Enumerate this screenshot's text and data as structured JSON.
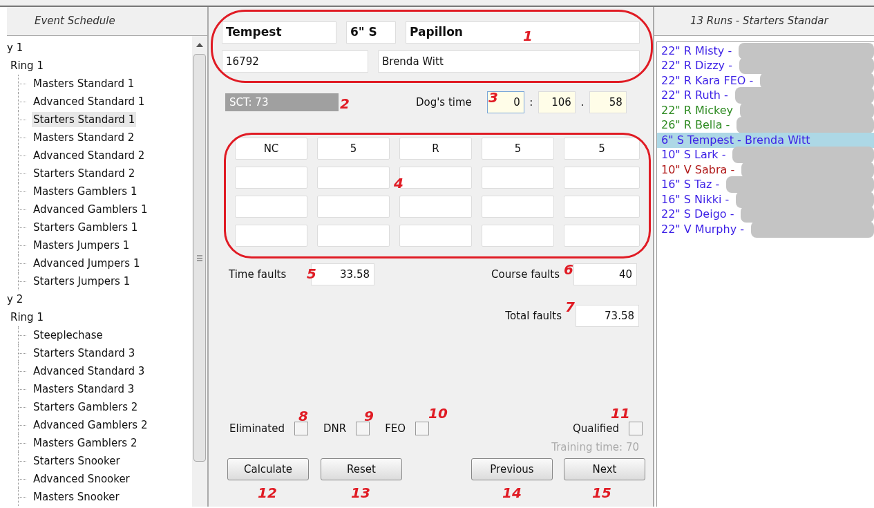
{
  "event_schedule": {
    "title": "Event Schedule",
    "tree": [
      {
        "label": "y 1",
        "expanded": true,
        "children": [
          {
            "label": "Ring 1",
            "expanded": true,
            "children": [
              {
                "label": "Masters Standard 1",
                "selected": false
              },
              {
                "label": "Advanced Standard 1",
                "selected": false
              },
              {
                "label": "Starters Standard 1",
                "selected": true
              },
              {
                "label": "Masters Standard 2",
                "selected": false
              },
              {
                "label": "Advanced Standard 2",
                "selected": false
              },
              {
                "label": "Starters Standard 2",
                "selected": false
              },
              {
                "label": "Masters Gamblers 1",
                "selected": false
              },
              {
                "label": "Advanced Gamblers 1",
                "selected": false
              },
              {
                "label": "Starters Gamblers 1",
                "selected": false
              },
              {
                "label": "Masters Jumpers 1",
                "selected": false
              },
              {
                "label": "Advanced Jumpers 1",
                "selected": false
              },
              {
                "label": "Starters Jumpers 1",
                "selected": false
              }
            ]
          }
        ]
      },
      {
        "label": "y 2",
        "expanded": true,
        "children": [
          {
            "label": "Ring 1",
            "expanded": true,
            "children": [
              {
                "label": "Steeplechase",
                "selected": false
              },
              {
                "label": "Starters Standard 3",
                "selected": false
              },
              {
                "label": "Advanced Standard 3",
                "selected": false
              },
              {
                "label": "Masters Standard 3",
                "selected": false
              },
              {
                "label": "Starters Gamblers 2",
                "selected": false
              },
              {
                "label": "Advanced Gamblers 2",
                "selected": false
              },
              {
                "label": "Masters Gamblers 2",
                "selected": false
              },
              {
                "label": "Starters Snooker",
                "selected": false
              },
              {
                "label": "Advanced Snooker",
                "selected": false
              },
              {
                "label": "Masters Snooker",
                "selected": false
              }
            ]
          }
        ]
      }
    ]
  },
  "entry": {
    "dog_name": "Tempest",
    "height_class": "6\" S",
    "breed": "Papillon",
    "number": "16792",
    "handler": "Brenda Witt"
  },
  "sct": "SCT:  73",
  "dogs_time": {
    "label": "Dog's time",
    "minutes": "0",
    "seconds": "106",
    "hundredths": "58",
    "separators": [
      ":",
      "."
    ]
  },
  "faults_grid": [
    {
      "kind": "entry",
      "cells": [
        "NC",
        "5",
        "R",
        "5",
        "5"
      ]
    },
    {
      "kind": "blank"
    },
    {
      "kind": "blank"
    },
    {
      "kind": "blank"
    }
  ],
  "time_faults": {
    "label": "Time faults",
    "value": "33.58"
  },
  "course_faults": {
    "label": "Course faults",
    "value": "40"
  },
  "total_faults": {
    "label": "Total faults",
    "value": "73.58"
  },
  "flags": [
    {
      "label": "Eliminated",
      "checked": false
    },
    {
      "label": "DNR",
      "checked": false
    },
    {
      "label": "FEO",
      "checked": false
    },
    {
      "label": "Qualified",
      "checked": false
    }
  ],
  "training_time": "Training time:  70",
  "buttons": [
    "Calculate",
    "Reset",
    "Previous",
    "Next"
  ],
  "runs": {
    "title": "13 Runs - Starters Standar",
    "items": [
      {
        "text": "22\" R  Misty  -",
        "color": "#3b1fe6",
        "selected": false,
        "redacted": true
      },
      {
        "text": "22\" R  Dizzy  -",
        "color": "#3b1fe6",
        "selected": false,
        "redacted": true
      },
      {
        "text": "22\" R  Kara FEO  -",
        "color": "#3b1fe6",
        "selected": false,
        "redacted": true
      },
      {
        "text": "22\" R  Ruth  -",
        "color": "#3b1fe6",
        "selected": false,
        "redacted": true
      },
      {
        "text": "22\" R  Mickey",
        "color": "#2e8b22",
        "selected": false,
        "redacted": true
      },
      {
        "text": "26\" R  Bella  -",
        "color": "#2e8b22",
        "selected": false,
        "redacted": true
      },
      {
        "text": "6\" S  Tempest  -  Brenda Witt",
        "color": "#3b1fe6",
        "selected": true,
        "redacted": false
      },
      {
        "text": "10\" S  Lark  -",
        "color": "#3b1fe6",
        "selected": false,
        "redacted": true
      },
      {
        "text": "10\" V  Sabra  -",
        "color": "#b01818",
        "selected": false,
        "redacted": true
      },
      {
        "text": "16\" S  Taz  -",
        "color": "#3b1fe6",
        "selected": false,
        "redacted": true
      },
      {
        "text": "16\" S  Nikki  -",
        "color": "#3b1fe6",
        "selected": false,
        "redacted": true
      },
      {
        "text": "22\" S  Deigo  -",
        "color": "#3b1fe6",
        "selected": false,
        "redacted": true
      },
      {
        "text": "22\" V  Murphy  -",
        "color": "#3b1fe6",
        "selected": false,
        "redacted": true
      }
    ]
  },
  "callouts": [
    "1",
    "2",
    "3",
    "4",
    "5",
    "6",
    "7",
    "8",
    "9",
    "10",
    "11",
    "12",
    "13",
    "14",
    "15"
  ]
}
